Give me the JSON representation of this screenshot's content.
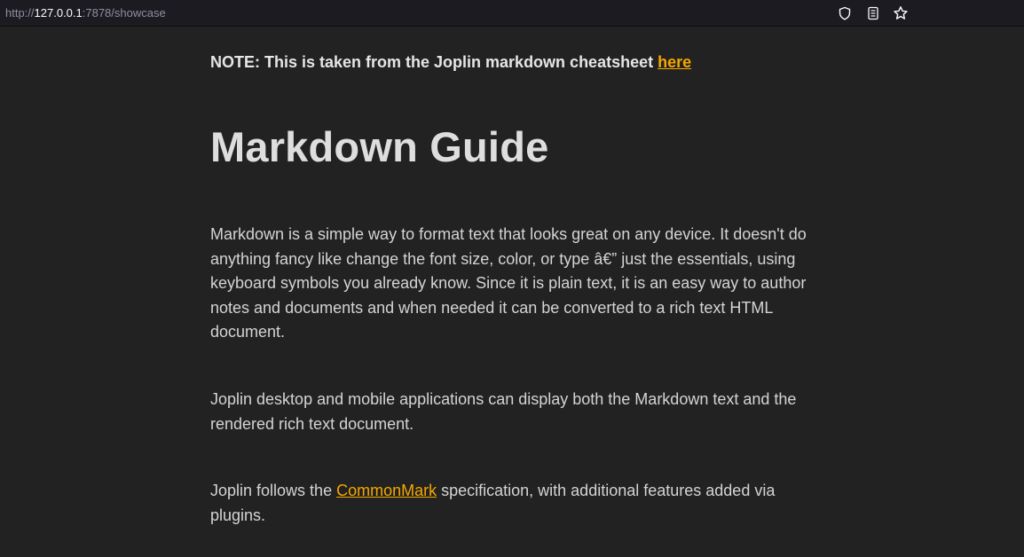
{
  "browser": {
    "url_prefix": "http://",
    "url_host": "127.0.0.1",
    "url_rest": ":7878/showcase",
    "icons": [
      "shield-icon",
      "reader-view-icon",
      "bookmark-star-icon"
    ]
  },
  "page": {
    "note_text": "NOTE: This is taken from the Joplin markdown cheatsheet ",
    "note_link": "here",
    "title": "Markdown Guide",
    "para1": "Markdown is a simple way to format text that looks great on any device. It doesn't do anything fancy like change the font size, color, or type â€” just the essentials, using keyboard symbols you already know. Since it is plain text, it is an easy way to author notes and documents and when needed it can be converted to a rich text HTML document.",
    "para2": "Joplin desktop and mobile applications can display both the Markdown text and the rendered rich text document.",
    "para3_before": "Joplin follows the ",
    "para3_link": "CommonMark",
    "para3_after": " specification, with additional features added via plugins."
  },
  "colors": {
    "background": "#222222",
    "text": "#d4d4d4",
    "link": "#f5a700",
    "toolbar": "#1c1b22"
  }
}
